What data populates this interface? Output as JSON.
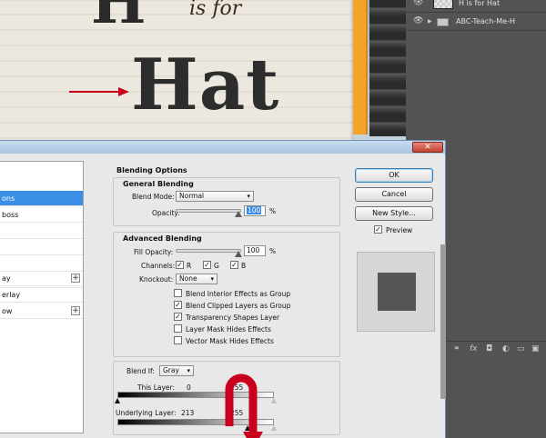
{
  "canvas": {
    "big_letter": "H",
    "is_for": "is for",
    "word": "Hat"
  },
  "layers_panel": {
    "layers": [
      {
        "name": "H is for Hat"
      },
      {
        "name": "ABC-Teach-Me-H"
      }
    ],
    "bottom_icons": [
      "link-icon",
      "fx-icon",
      "mask-icon",
      "adjustment-icon",
      "folder-icon",
      "new-layer-icon",
      "trash-icon"
    ]
  },
  "dialog": {
    "close_label": "✕",
    "styles": [
      {
        "label": "ons",
        "selected": true
      },
      {
        "label": "boss",
        "selected": false
      },
      {
        "label": "",
        "selected": false
      },
      {
        "label": "",
        "selected": false
      },
      {
        "label": "",
        "selected": false
      },
      {
        "label": "",
        "selected": false
      },
      {
        "label": "ay",
        "selected": false,
        "plus": true
      },
      {
        "label": "erlay",
        "selected": false
      },
      {
        "label": "ow",
        "selected": false,
        "plus": true
      }
    ],
    "blending_options": {
      "title": "Blending Options",
      "general": {
        "title": "General Blending",
        "blend_mode_label": "Blend Mode:",
        "blend_mode": "Normal",
        "opacity_label": "Opacity:",
        "opacity_value": "100",
        "opacity_unit": "%"
      },
      "advanced": {
        "title": "Advanced Blending",
        "fill_opacity_label": "Fill Opacity:",
        "fill_opacity_value": "100",
        "fill_opacity_unit": "%",
        "channels_label": "Channels:",
        "channels": [
          {
            "label": "R",
            "checked": true
          },
          {
            "label": "G",
            "checked": true
          },
          {
            "label": "B",
            "checked": true
          }
        ],
        "knockout_label": "Knockout:",
        "knockout_value": "None",
        "options": [
          {
            "label": "Blend Interior Effects as Group",
            "checked": false
          },
          {
            "label": "Blend Clipped Layers as Group",
            "checked": true
          },
          {
            "label": "Transparency Shapes Layer",
            "checked": true
          },
          {
            "label": "Layer Mask Hides Effects",
            "checked": false
          },
          {
            "label": "Vector Mask Hides Effects",
            "checked": false
          }
        ]
      },
      "blend_if": {
        "label": "Blend If:",
        "value": "Gray",
        "this_layer_label": "This Layer:",
        "this_layer_min": "0",
        "this_layer_max": "255",
        "underlying_label": "Underlying Layer:",
        "underlying_min": "213",
        "underlying_max": "255",
        "this_layer_range": [
          0,
          255
        ],
        "underlying_range": [
          213,
          255
        ]
      }
    },
    "buttons": {
      "ok": "OK",
      "cancel": "Cancel",
      "new_style": "New Style...",
      "preview": "Preview",
      "preview_checked": true
    },
    "colors": {
      "selected_row": "#3b8ee6",
      "annotation_arrow": "#c8001e",
      "preview_swatch": "#555555"
    }
  }
}
